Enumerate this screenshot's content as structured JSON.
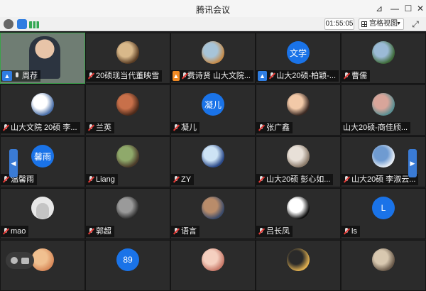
{
  "window": {
    "title": "腾讯会议"
  },
  "toolbar": {
    "timer": "01:55:05",
    "view_label": "宫格视图"
  },
  "colors": {
    "video_border": "#3aa34a",
    "avatar_blue": "#1a73e8",
    "nav_blue": "#3a7bd5"
  },
  "tiles": [
    {
      "name": "周荐",
      "type": "video",
      "mic": "on",
      "host": true
    },
    {
      "name": "20硕现当代董映雪",
      "type": "photo",
      "mic": "off",
      "avatar_colors": [
        "#d8b88a",
        "#5a3d24"
      ]
    },
    {
      "name": "费诗贤  山大文院...",
      "type": "photo",
      "mic": "off",
      "badge": "orange",
      "avatar_colors": [
        "#a7c4d8",
        "#c58b4a"
      ]
    },
    {
      "name": "山大20硕-柏颖-...",
      "type": "text",
      "avatar_text": "文学",
      "mic": "off",
      "host": true
    },
    {
      "name": "曹儒",
      "type": "photo",
      "mic": "off",
      "avatar_colors": [
        "#9bbad6",
        "#3f6b3a"
      ]
    },
    {
      "name": "山大文院 20硕  李...",
      "type": "photo",
      "mic": "off",
      "avatar_colors": [
        "#ffffff",
        "#4a6fa8"
      ]
    },
    {
      "name": "兰英",
      "type": "photo",
      "mic": "off",
      "avatar_colors": [
        "#c8704a",
        "#4d2a1a"
      ]
    },
    {
      "name": "凝儿",
      "type": "text",
      "avatar_text": "凝儿",
      "mic": "off"
    },
    {
      "name": "张广鑫",
      "type": "photo",
      "mic": "off",
      "avatar_colors": [
        "#f2c9a8",
        "#3b2a24"
      ]
    },
    {
      "name": "山大20硕-商佳颀...",
      "type": "photo",
      "mic": "none",
      "avatar_colors": [
        "#d8a59a",
        "#5a8f93"
      ]
    },
    {
      "name": "温馨雨",
      "type": "text",
      "avatar_text": "馨雨",
      "mic": "off"
    },
    {
      "name": "Liang",
      "type": "photo",
      "mic": "off",
      "avatar_colors": [
        "#8fa96b",
        "#4b3b2a"
      ]
    },
    {
      "name": "ZY",
      "type": "photo",
      "mic": "off",
      "avatar_colors": [
        "#cde3f5",
        "#2b4a8a"
      ]
    },
    {
      "name": "山大20硕  彭心如...",
      "type": "photo",
      "mic": "off",
      "avatar_colors": [
        "#e8e0d8",
        "#8a7a6a"
      ]
    },
    {
      "name": "山大20硕  李淑云...",
      "type": "photo",
      "mic": "off",
      "avatar_colors": [
        "#6f9bd1",
        "#e8eef5"
      ]
    },
    {
      "name": "mao",
      "type": "placeholder",
      "mic": "off"
    },
    {
      "name": "郭超",
      "type": "photo",
      "mic": "off",
      "avatar_colors": [
        "#9a9a9a",
        "#2a2a2a"
      ]
    },
    {
      "name": "语言",
      "type": "photo",
      "mic": "off",
      "avatar_colors": [
        "#b98c6a",
        "#3a4a6a"
      ]
    },
    {
      "name": "吕长凤",
      "type": "photo",
      "mic": "off",
      "avatar_colors": [
        "#ffffff",
        "#111111"
      ]
    },
    {
      "name": "ls",
      "type": "text",
      "avatar_text": "L",
      "mic": "off"
    },
    {
      "name": "",
      "type": "photo",
      "mic": "none",
      "avatar_colors": [
        "#f0c090",
        "#d88a5a"
      ]
    },
    {
      "name": "",
      "type": "text",
      "avatar_text": "89",
      "mic": "none"
    },
    {
      "name": "",
      "type": "photo",
      "mic": "none",
      "avatar_colors": [
        "#f5d0c0",
        "#c87a6a"
      ]
    },
    {
      "name": "",
      "type": "photo",
      "mic": "none",
      "avatar_colors": [
        "#2a2a2a",
        "#e0b050"
      ]
    },
    {
      "name": "",
      "type": "photo",
      "mic": "none",
      "avatar_colors": [
        "#d8c8b0",
        "#6a5a4a"
      ]
    }
  ]
}
